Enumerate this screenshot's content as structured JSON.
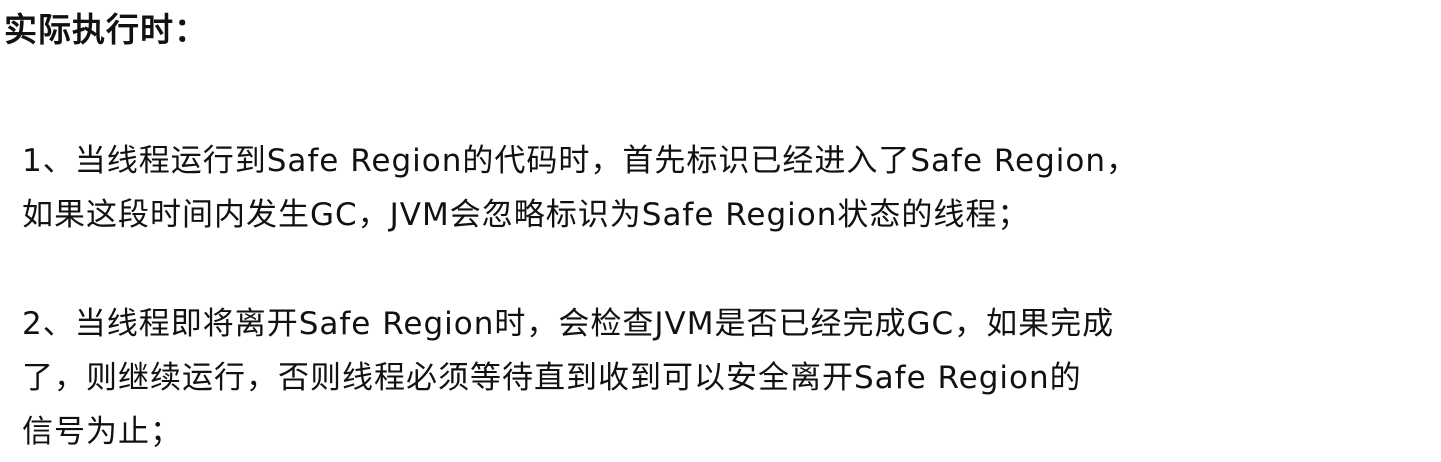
{
  "heading": "实际执行时：",
  "paragraph1": {
    "line1": "1、当线程运行到Safe Region的代码时，首先标识已经进入了Safe Region，",
    "line2": "如果这段时间内发生GC，JVM会忽略标识为Safe Region状态的线程；"
  },
  "paragraph2": {
    "line1": "2、当线程即将离开Safe Region时，会检查JVM是否已经完成GC，如果完成",
    "line2": "了，则继续运行，否则线程必须等待直到收到可以安全离开Safe Region的",
    "line3": "信号为止；"
  }
}
